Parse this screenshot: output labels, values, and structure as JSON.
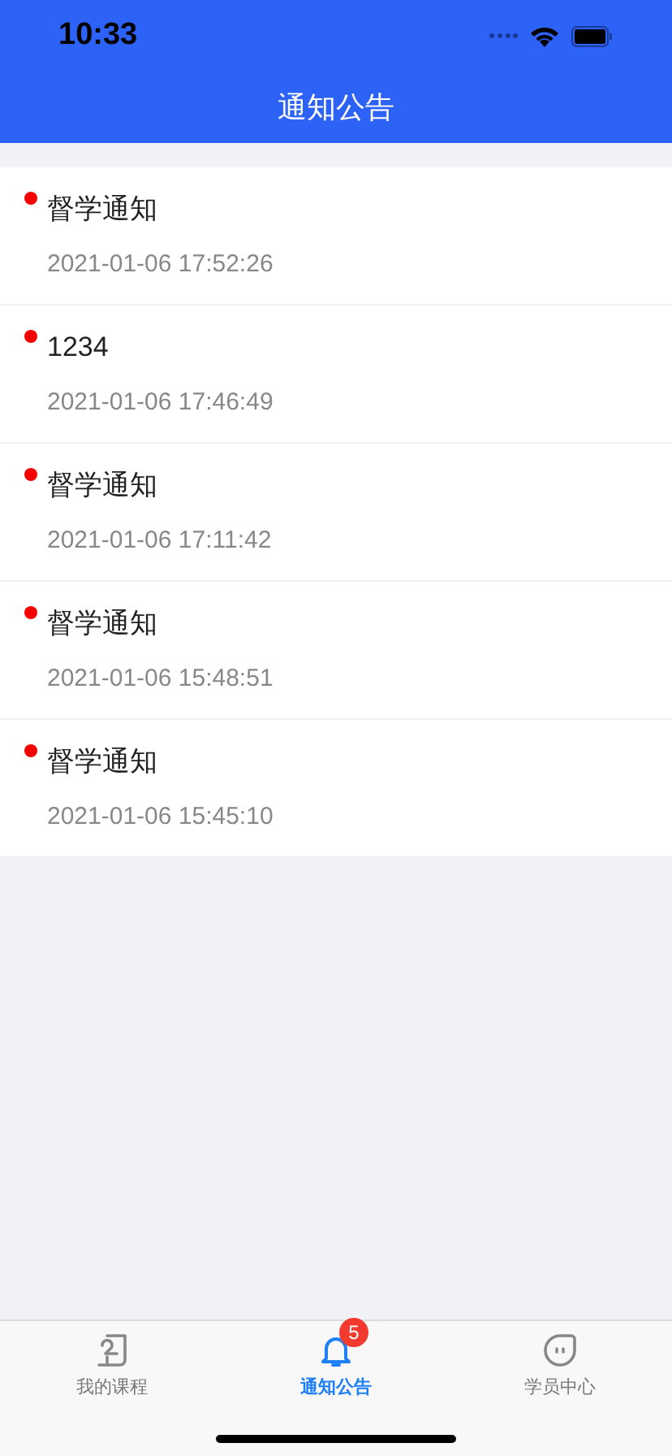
{
  "status_bar": {
    "time": "10:33"
  },
  "nav": {
    "title": "通知公告"
  },
  "notices": [
    {
      "title": "督学通知",
      "time": "2021-01-06 17:52:26",
      "unread": true
    },
    {
      "title": "1234",
      "time": "2021-01-06 17:46:49",
      "unread": true
    },
    {
      "title": "督学通知",
      "time": "2021-01-06 17:11:42",
      "unread": true
    },
    {
      "title": "督学通知",
      "time": "2021-01-06 15:48:51",
      "unread": true
    },
    {
      "title": "督学通知",
      "time": "2021-01-06 15:45:10",
      "unread": true
    }
  ],
  "tabs": [
    {
      "kind": "courses",
      "label": "我的课程",
      "selected": false
    },
    {
      "kind": "notices",
      "label": "通知公告",
      "selected": true,
      "badge": "5"
    },
    {
      "kind": "profile",
      "label": "学员中心",
      "selected": false
    }
  ]
}
